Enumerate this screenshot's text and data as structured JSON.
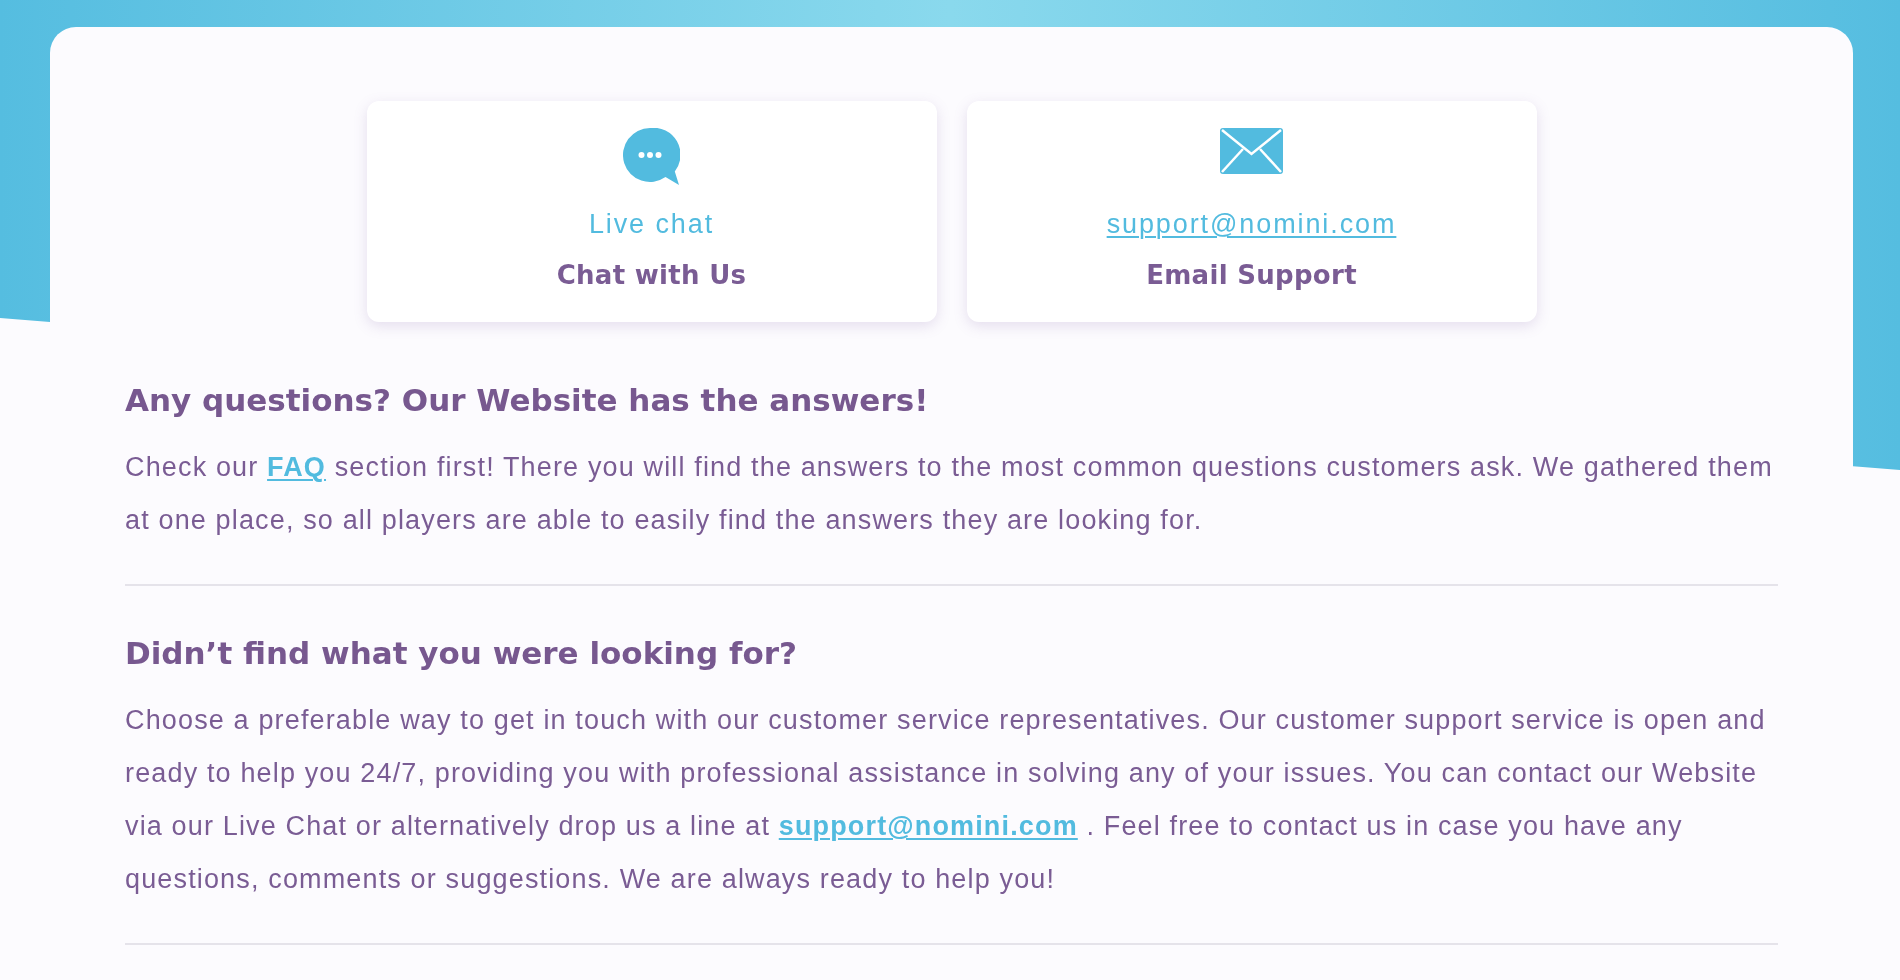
{
  "contact_cards": [
    {
      "kind": "chat",
      "link": "Live chat",
      "title": "Chat with Us"
    },
    {
      "kind": "email",
      "link": "support@nomini.com",
      "title": "Email Support"
    }
  ],
  "sections": [
    {
      "heading": "Any questions? Our Website has the answers!",
      "paragraph": [
        {
          "kind": "text",
          "text": "Check our "
        },
        {
          "kind": "link",
          "text": "FAQ"
        },
        {
          "kind": "text",
          "text": " section first! There you will find the answers to the most common questions customers ask. We gathered them at one place, so all players are able to easily find the answers they are looking for."
        }
      ]
    },
    {
      "heading": "Didn’t find what you were looking for?",
      "paragraph": [
        {
          "kind": "text",
          "text": "Choose a preferable way to get in touch with our customer service representatives. Our customer support service is open and ready to help you 24/7, providing you with professional assistance in solving any of your issues. You can contact our Website via our Live Chat or alternatively drop us a line at "
        },
        {
          "kind": "link",
          "text": "support@nomini.com"
        },
        {
          "kind": "text",
          "text": " . Feel free to contact us in case you have any questions, comments or suggestions. We are always ready to help you!"
        }
      ]
    }
  ]
}
